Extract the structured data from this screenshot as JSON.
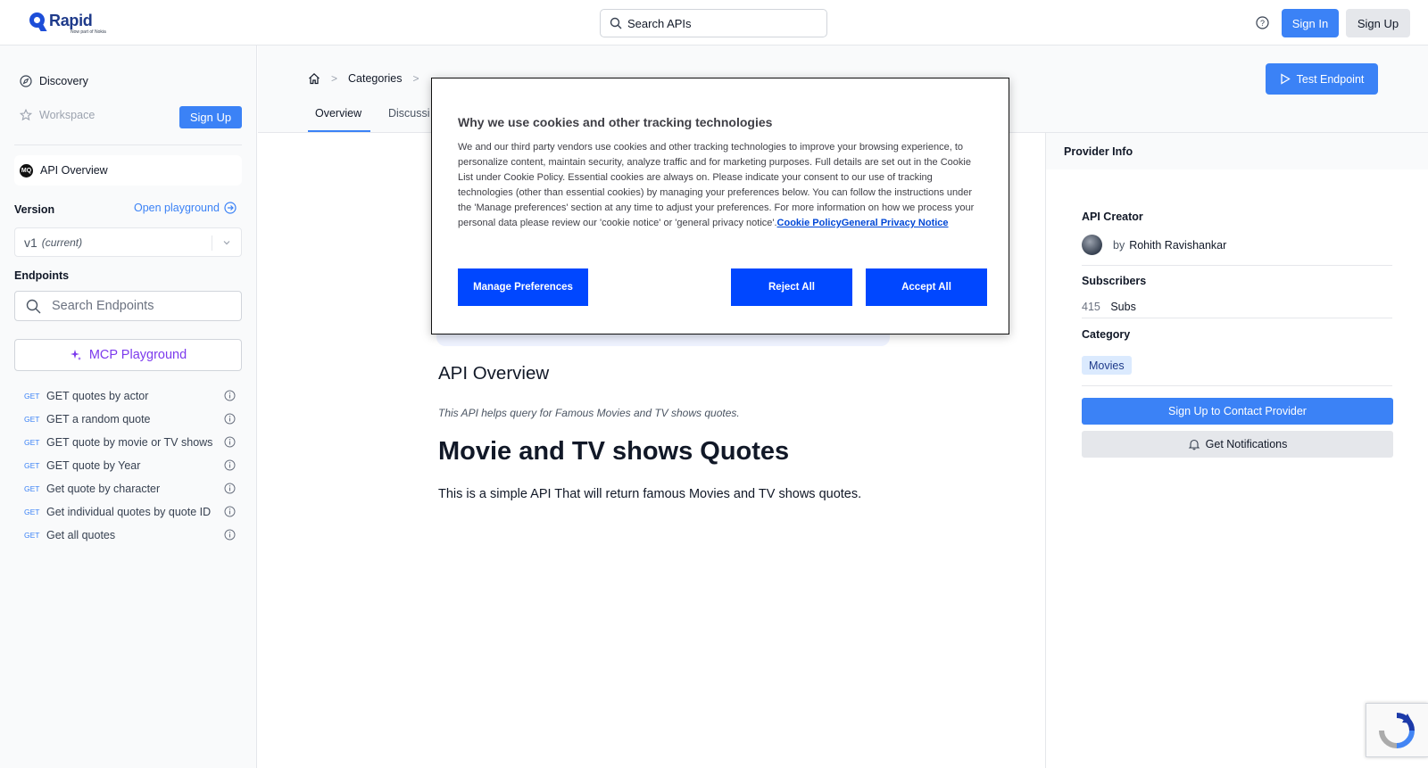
{
  "brand": {
    "name": "Rapid",
    "tagline": "Now part of Nokia"
  },
  "topbar": {
    "search_placeholder": "Search APIs",
    "sign_in": "Sign In",
    "sign_up": "Sign Up"
  },
  "sidebar": {
    "discovery": "Discovery",
    "workspace": "Workspace",
    "sign_up": "Sign Up",
    "api_overview": "API Overview",
    "api_badge": "MQ",
    "version_label": "Version",
    "open_playground": "Open playground",
    "version_value": "v1",
    "version_current": "(current)",
    "endpoints_label": "Endpoints",
    "search_endpoints_placeholder": "Search Endpoints",
    "mcp_playground": "MCP Playground",
    "endpoints": [
      {
        "method": "GET",
        "name": "GET quotes by actor"
      },
      {
        "method": "GET",
        "name": "GET a random quote"
      },
      {
        "method": "GET",
        "name": "GET quote by movie or TV shows"
      },
      {
        "method": "GET",
        "name": "GET quote by Year"
      },
      {
        "method": "GET",
        "name": "Get quote by character"
      },
      {
        "method": "GET",
        "name": "Get individual quotes by quote ID"
      },
      {
        "method": "GET",
        "name": "Get all quotes"
      }
    ]
  },
  "header": {
    "breadcrumb": {
      "categories": "Categories"
    },
    "tabs": {
      "overview": "Overview",
      "discussions": "Discussi"
    },
    "test_endpoint": "Test Endpoint"
  },
  "content": {
    "overview_title": "API Overview",
    "overview_desc": "This API helps query for Famous Movies and TV shows quotes.",
    "heading": "Movie and TV shows Quotes",
    "body": "This is a simple API That will return famous Movies and TV shows quotes."
  },
  "provider": {
    "panel_title": "Provider Info",
    "creator_label": "API Creator",
    "creator_by": "by",
    "creator_name": "Rohith Ravishankar",
    "subscribers_label": "Subscribers",
    "subscribers_count": "415",
    "subscribers_unit": "Subs",
    "category_label": "Category",
    "category_value": "Movies",
    "contact_button": "Sign Up to Contact Provider",
    "notify_button": "Get Notifications"
  },
  "cookie_modal": {
    "title": "Why we use cookies and other tracking technologies",
    "body": "We and our third party vendors use cookies and other tracking technologies to improve your browsing experience, to personalize content, maintain security, analyze traffic and for marketing purposes. Full details are set out in the Cookie List under Cookie Policy. Essential cookies are always on. Please indicate your consent to our use of tracking technologies (other than essential cookies) by managing your preferences below. You can follow the instructions under the 'Manage preferences' section at any time to adjust your preferences. For more information on how we process your personal data please review our 'cookie notice' or 'general privacy notice'.",
    "link_cookie_policy": "Cookie Policy",
    "link_privacy_notice": "General Privacy Notice",
    "manage_preferences": "Manage Preferences",
    "reject_all": "Reject All",
    "accept_all": "Accept All"
  },
  "colors": {
    "primary": "#3b82f6",
    "cookie_button": "#0047ff",
    "mcp_accent": "#7c3aed"
  }
}
